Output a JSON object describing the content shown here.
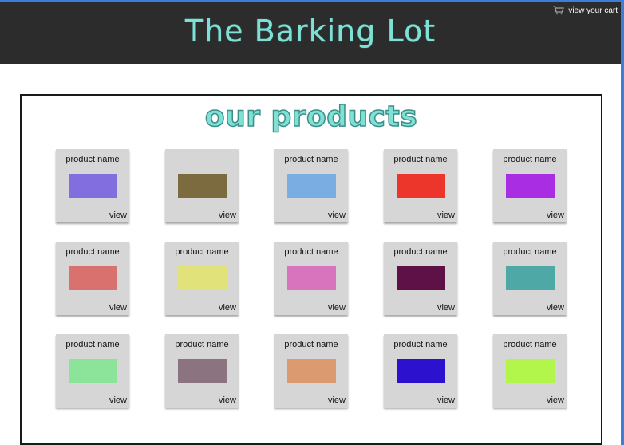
{
  "header": {
    "brand": "The Barking Lot",
    "cart_label": "view your cart"
  },
  "main": {
    "section_title": "our products",
    "products": [
      {
        "name": "product name",
        "view": "view",
        "color": "#836ee0"
      },
      {
        "name": "",
        "view": "view",
        "color": "#7b6b3f"
      },
      {
        "name": "product name",
        "view": "view",
        "color": "#7aaee2"
      },
      {
        "name": "product name",
        "view": "view",
        "color": "#ec352b"
      },
      {
        "name": "product name",
        "view": "view",
        "color": "#a92de3"
      },
      {
        "name": "product name",
        "view": "view",
        "color": "#d9726e"
      },
      {
        "name": "product name",
        "view": "view",
        "color": "#e2e27a"
      },
      {
        "name": "product name",
        "view": "view",
        "color": "#d874be"
      },
      {
        "name": "product name",
        "view": "view",
        "color": "#5d1147"
      },
      {
        "name": "product name",
        "view": "view",
        "color": "#4ea8a6"
      },
      {
        "name": "product name",
        "view": "view",
        "color": "#8ce49a"
      },
      {
        "name": "product name",
        "view": "view",
        "color": "#8b737f"
      },
      {
        "name": "product name",
        "view": "view",
        "color": "#dc9a70"
      },
      {
        "name": "product name",
        "view": "view",
        "color": "#2c12cf"
      },
      {
        "name": "product name",
        "view": "view",
        "color": "#b2f54b"
      }
    ]
  }
}
